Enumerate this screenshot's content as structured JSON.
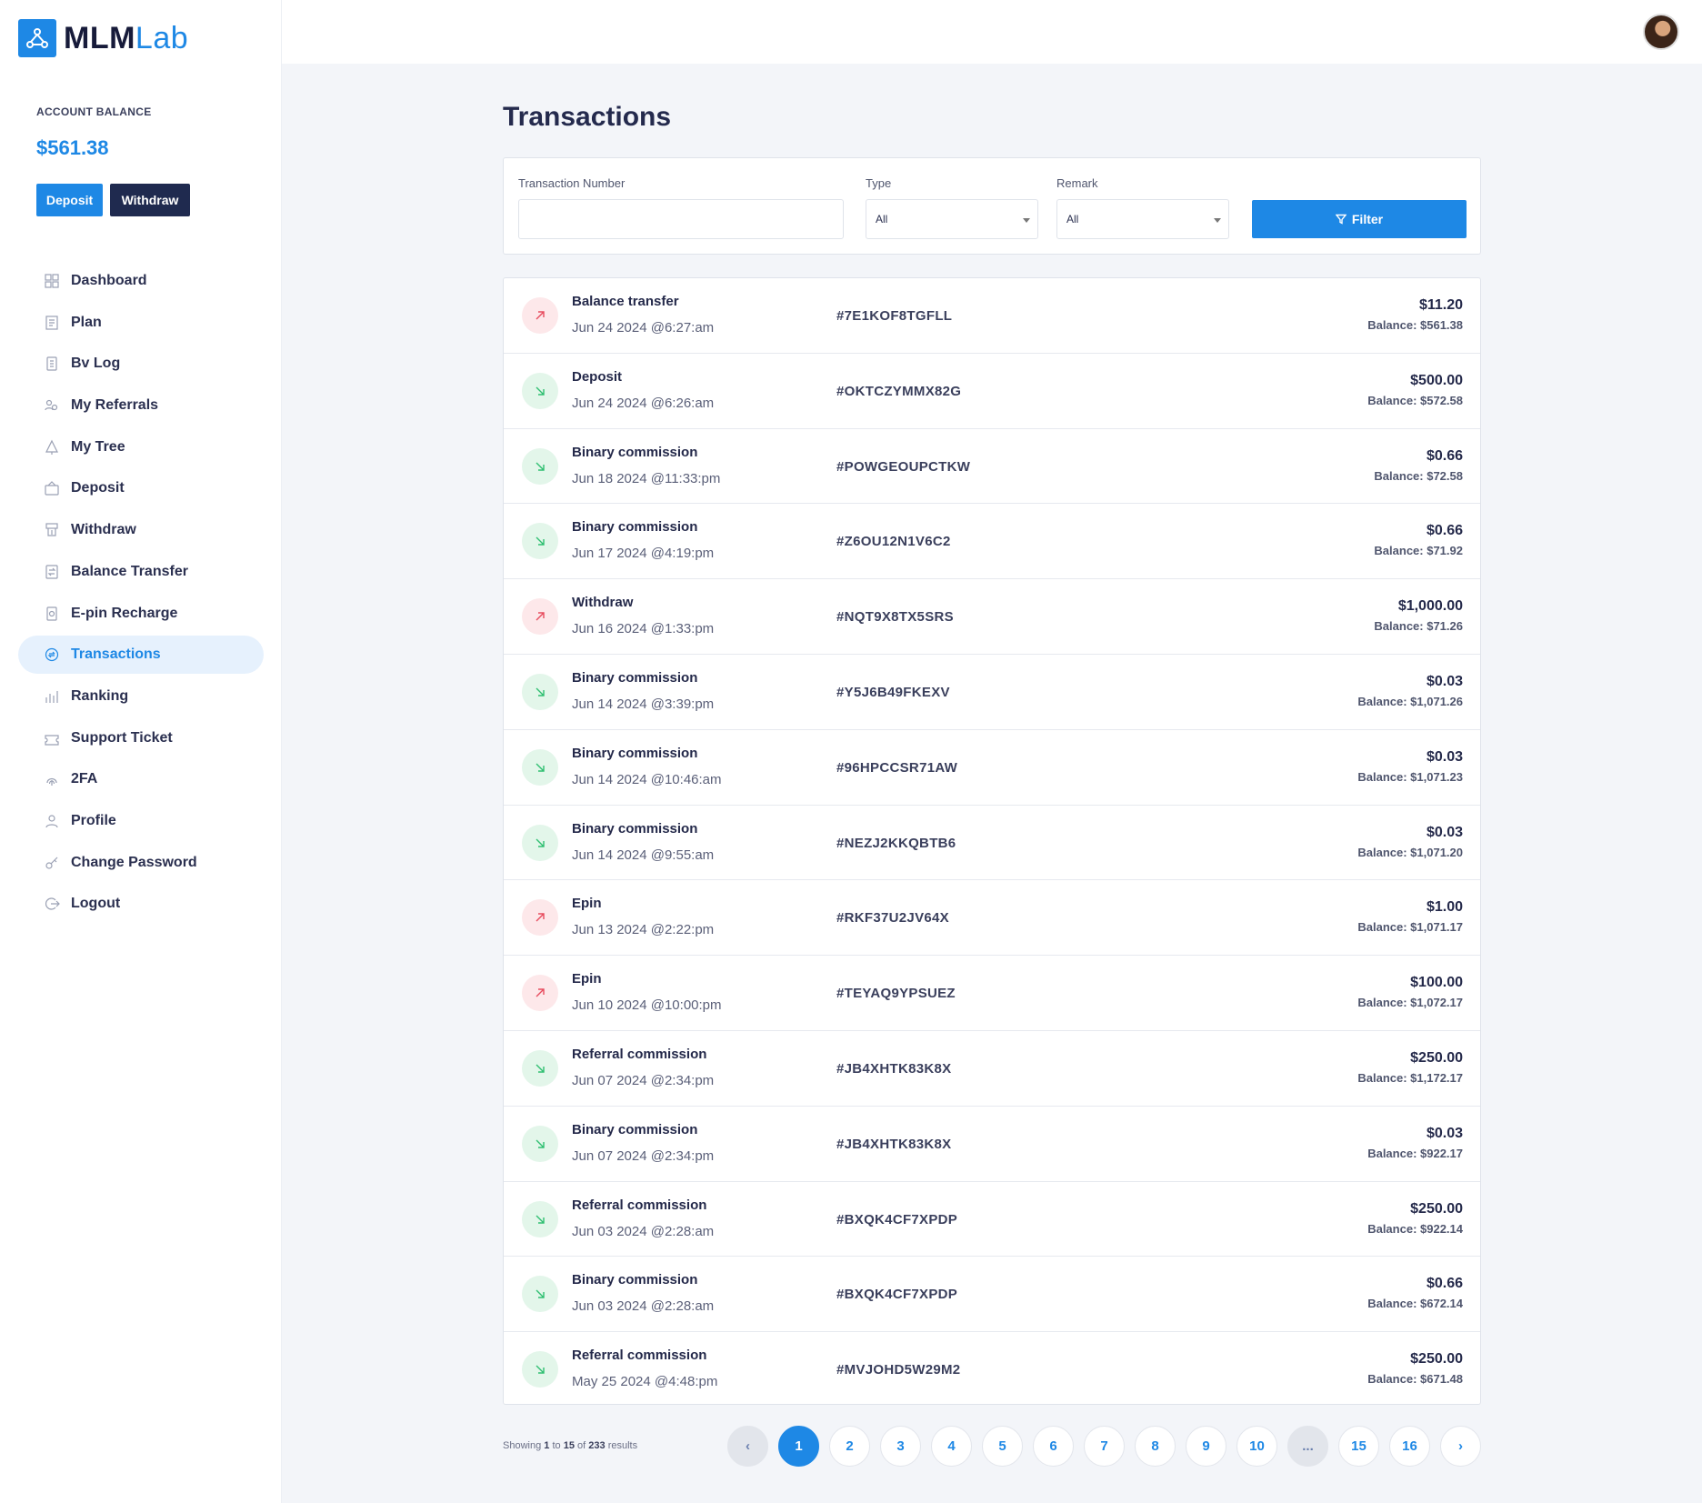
{
  "brand": {
    "part1": "MLM",
    "part2": "Lab",
    "accent": "#1e88e5"
  },
  "balance": {
    "label": "ACCOUNT BALANCE",
    "value": "$561.38",
    "deposit_label": "Deposit",
    "withdraw_label": "Withdraw"
  },
  "nav": [
    {
      "label": "Dashboard",
      "icon": "dashboard-icon"
    },
    {
      "label": "Plan",
      "icon": "plan-icon"
    },
    {
      "label": "Bv Log",
      "icon": "bv-log-icon"
    },
    {
      "label": "My Referrals",
      "icon": "referrals-icon"
    },
    {
      "label": "My Tree",
      "icon": "tree-icon"
    },
    {
      "label": "Deposit",
      "icon": "deposit-icon"
    },
    {
      "label": "Withdraw",
      "icon": "withdraw-icon"
    },
    {
      "label": "Balance Transfer",
      "icon": "balance-transfer-icon"
    },
    {
      "label": "E-pin Recharge",
      "icon": "epin-icon"
    },
    {
      "label": "Transactions",
      "icon": "transactions-icon",
      "active": true
    },
    {
      "label": "Ranking",
      "icon": "ranking-icon"
    },
    {
      "label": "Support Ticket",
      "icon": "ticket-icon"
    },
    {
      "label": "2FA",
      "icon": "fingerprint-icon"
    },
    {
      "label": "Profile",
      "icon": "user-icon"
    },
    {
      "label": "Change Password",
      "icon": "key-icon"
    },
    {
      "label": "Logout",
      "icon": "logout-icon"
    }
  ],
  "page": {
    "title": "Transactions"
  },
  "filter": {
    "trx_label": "Transaction Number",
    "trx_value": "",
    "type_label": "Type",
    "type_value": "All",
    "remark_label": "Remark",
    "remark_value": "All",
    "button_label": "Filter"
  },
  "transactions": [
    {
      "title": "Balance transfer",
      "date": "Jun 24 2024 @6:27:am",
      "trx": "#7E1KOF8TGFLL",
      "amount": "$11.20",
      "balance": "Balance: $561.38",
      "direction": "out"
    },
    {
      "title": "Deposit",
      "date": "Jun 24 2024 @6:26:am",
      "trx": "#OKTCZYMMX82G",
      "amount": "$500.00",
      "balance": "Balance: $572.58",
      "direction": "in"
    },
    {
      "title": "Binary commission",
      "date": "Jun 18 2024 @11:33:pm",
      "trx": "#POWGEOUPCTKW",
      "amount": "$0.66",
      "balance": "Balance: $72.58",
      "direction": "in"
    },
    {
      "title": "Binary commission",
      "date": "Jun 17 2024 @4:19:pm",
      "trx": "#Z6OU12N1V6C2",
      "amount": "$0.66",
      "balance": "Balance: $71.92",
      "direction": "in"
    },
    {
      "title": "Withdraw",
      "date": "Jun 16 2024 @1:33:pm",
      "trx": "#NQT9X8TX5SRS",
      "amount": "$1,000.00",
      "balance": "Balance: $71.26",
      "direction": "out"
    },
    {
      "title": "Binary commission",
      "date": "Jun 14 2024 @3:39:pm",
      "trx": "#Y5J6B49FKEXV",
      "amount": "$0.03",
      "balance": "Balance: $1,071.26",
      "direction": "in"
    },
    {
      "title": "Binary commission",
      "date": "Jun 14 2024 @10:46:am",
      "trx": "#96HPCCSR71AW",
      "amount": "$0.03",
      "balance": "Balance: $1,071.23",
      "direction": "in"
    },
    {
      "title": "Binary commission",
      "date": "Jun 14 2024 @9:55:am",
      "trx": "#NEZJ2KKQBTB6",
      "amount": "$0.03",
      "balance": "Balance: $1,071.20",
      "direction": "in"
    },
    {
      "title": "Epin",
      "date": "Jun 13 2024 @2:22:pm",
      "trx": "#RKF37U2JV64X",
      "amount": "$1.00",
      "balance": "Balance: $1,071.17",
      "direction": "out"
    },
    {
      "title": "Epin",
      "date": "Jun 10 2024 @10:00:pm",
      "trx": "#TEYAQ9YPSUEZ",
      "amount": "$100.00",
      "balance": "Balance: $1,072.17",
      "direction": "out"
    },
    {
      "title": "Referral commission",
      "date": "Jun 07 2024 @2:34:pm",
      "trx": "#JB4XHTK83K8X",
      "amount": "$250.00",
      "balance": "Balance: $1,172.17",
      "direction": "in"
    },
    {
      "title": "Binary commission",
      "date": "Jun 07 2024 @2:34:pm",
      "trx": "#JB4XHTK83K8X",
      "amount": "$0.03",
      "balance": "Balance: $922.17",
      "direction": "in"
    },
    {
      "title": "Referral commission",
      "date": "Jun 03 2024 @2:28:am",
      "trx": "#BXQK4CF7XPDP",
      "amount": "$250.00",
      "balance": "Balance: $922.14",
      "direction": "in"
    },
    {
      "title": "Binary commission",
      "date": "Jun 03 2024 @2:28:am",
      "trx": "#BXQK4CF7XPDP",
      "amount": "$0.66",
      "balance": "Balance: $672.14",
      "direction": "in"
    },
    {
      "title": "Referral commission",
      "date": "May 25 2024 @4:48:pm",
      "trx": "#MVJOHD5W29M2",
      "amount": "$250.00",
      "balance": "Balance: $671.48",
      "direction": "in"
    }
  ],
  "results": {
    "prefix": "Showing",
    "from": "1",
    "to_word": "to",
    "to": "15",
    "of_word": "of",
    "total": "233",
    "suffix": "results"
  },
  "pagination": [
    {
      "label": "‹",
      "kind": "prev"
    },
    {
      "label": "1",
      "kind": "active"
    },
    {
      "label": "2"
    },
    {
      "label": "3"
    },
    {
      "label": "4"
    },
    {
      "label": "5"
    },
    {
      "label": "6"
    },
    {
      "label": "7"
    },
    {
      "label": "8"
    },
    {
      "label": "9"
    },
    {
      "label": "10"
    },
    {
      "label": "...",
      "kind": "ellipsis"
    },
    {
      "label": "15"
    },
    {
      "label": "16"
    },
    {
      "label": "›",
      "kind": "next"
    }
  ]
}
